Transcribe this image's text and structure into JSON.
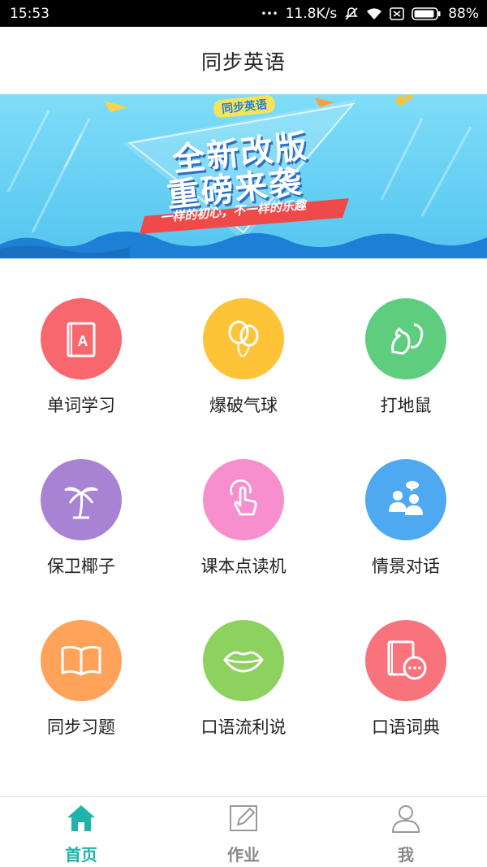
{
  "status_bar": {
    "time": "15:53",
    "dots": "•••",
    "speed": "11.8K/s",
    "battery": "88%"
  },
  "header": {
    "title": "同步英语"
  },
  "banner": {
    "badge": "同步英语",
    "headline_1": "全新改版",
    "headline_2": "重磅来袭",
    "ribbon": "一样的初心，不一样的乐趣"
  },
  "grid": {
    "items": [
      {
        "label": "单词学习",
        "color": "#F8676E",
        "icon": "letter-a-book-icon"
      },
      {
        "label": "爆破气球",
        "color": "#FFC338",
        "icon": "balloon-icon"
      },
      {
        "label": "打地鼠",
        "color": "#5ECE7E",
        "icon": "squirrel-icon"
      },
      {
        "label": "保卫椰子",
        "color": "#A983D3",
        "icon": "palm-tree-icon"
      },
      {
        "label": "课本点读机",
        "color": "#F78FCF",
        "icon": "tap-finger-icon"
      },
      {
        "label": "情景对话",
        "color": "#4FA9F1",
        "icon": "dialogue-people-icon"
      },
      {
        "label": "同步习题",
        "color": "#FFA25A",
        "icon": "open-book-icon"
      },
      {
        "label": "口语流利说",
        "color": "#8DD25E",
        "icon": "lips-icon"
      },
      {
        "label": "口语词典",
        "color": "#F8737C",
        "icon": "dictionary-chat-icon"
      }
    ]
  },
  "tabbar": {
    "tabs": [
      {
        "label": "首页",
        "icon": "home-icon",
        "active": true
      },
      {
        "label": "作业",
        "icon": "edit-icon",
        "active": false
      },
      {
        "label": "我",
        "icon": "user-icon",
        "active": false
      }
    ],
    "active_color": "#1FB3AC",
    "inactive_color": "#888888"
  }
}
